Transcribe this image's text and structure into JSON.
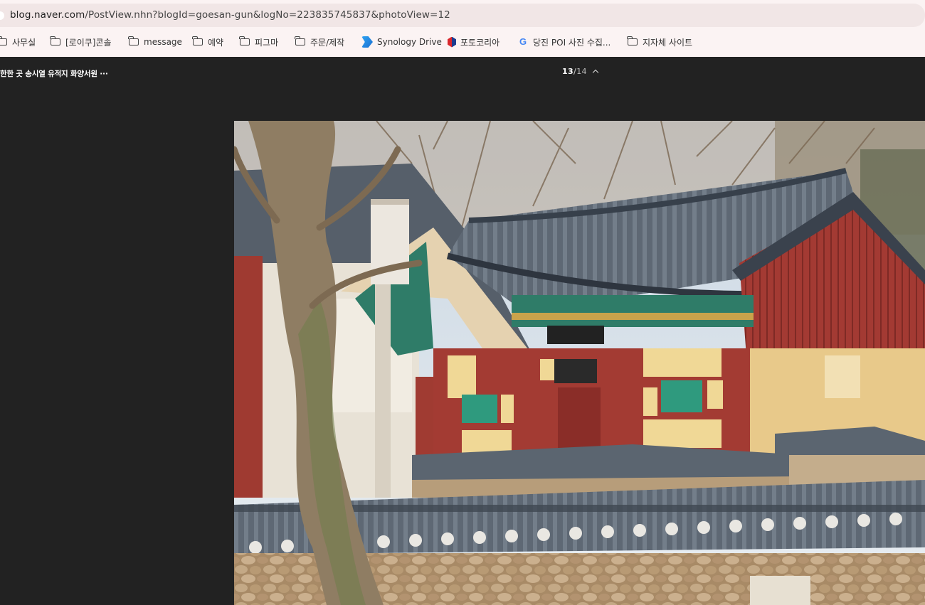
{
  "browser": {
    "url_domain": "blog.naver.com",
    "url_path": "/PostView.nhn?blogId=goesan-gun&logNo=223835745837&photoView=12",
    "bookmarks": [
      {
        "label": "사무실",
        "icon": "folder-icon"
      },
      {
        "label": "[로이쿠]콘솔",
        "icon": "folder-icon"
      },
      {
        "label": "message",
        "icon": "folder-icon"
      },
      {
        "label": "예약",
        "icon": "folder-icon"
      },
      {
        "label": "피그마",
        "icon": "folder-icon"
      },
      {
        "label": "주문/제작",
        "icon": "folder-icon"
      },
      {
        "label": "Synology Drive",
        "icon": "synology-drive-icon"
      },
      {
        "label": "포토코리아",
        "icon": "photokorea-icon"
      },
      {
        "label": "당진 POI 사진 수집...",
        "icon": "google-icon"
      },
      {
        "label": "지자체 사이트",
        "icon": "folder-icon"
      }
    ]
  },
  "viewer": {
    "title": "한한 곳 송시열 유적지 화양서원 ···",
    "current": "13",
    "separator": "/",
    "total": "14",
    "photo_icon": "traditional-korean-building-photo",
    "colors": {
      "background": "#222222",
      "chrome": "#fbf3f3"
    }
  }
}
